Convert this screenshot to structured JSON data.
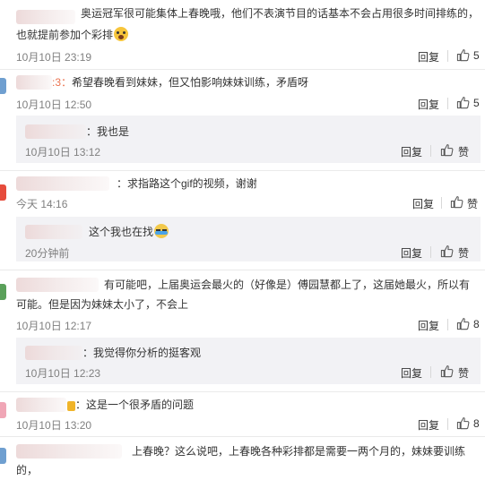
{
  "colors": {
    "mention": "#eb7350",
    "time": "#808080",
    "subcomment_bg": "#f2f2f5",
    "avatar_red": "#e64c3c",
    "avatar_blue": "#6fa8dc",
    "avatar_green": "#5aa05a",
    "avatar_pink": "#f0a6b6"
  },
  "icons": {
    "like": "thumbs-up-icon",
    "fear_emoji": "fear-face-emoji",
    "cry_emoji": "crying-face-emoji"
  },
  "comments": [
    {
      "text_line1": "奥运冠军很可能集体上春晚哦，他们不表演节目的话基本不会占用很多时间排练的，",
      "text_line2": "也就提前参加个彩排",
      "time": "10月10日 23:19",
      "reply": "回复",
      "likes": "5"
    },
    {
      "mention_suffix": ":3：",
      "text": "希望春晚看到妹妹，但又怕影响妹妹训练，矛盾呀",
      "time": "10月10日 12:50",
      "reply": "回复",
      "likes": "5",
      "subreply": {
        "text": "：我也是",
        "time": "10月10日 13:12",
        "reply": "回复",
        "likes": "赞"
      }
    },
    {
      "text": "：求指路这个gif的视频，谢谢",
      "time": "今天 14:16",
      "reply": "回复",
      "likes": "赞",
      "subreply": {
        "text": "这个我也在找",
        "time": "20分钟前",
        "reply": "回复",
        "likes": "赞"
      }
    },
    {
      "text_line1": "有可能吧，上届奥运会最火的（好像是）傅园慧都上了，这届她最火，所以有",
      "text_line2": "可能。但是因为妹妹太小了，不会上",
      "time": "10月10日 12:17",
      "reply": "回复",
      "likes": "8",
      "subreply": {
        "text": "：我觉得你分析的挺客观",
        "time": "10月10日 12:23",
        "reply": "回复",
        "likes": "赞"
      }
    },
    {
      "text": "：这是一个很矛盾的问题",
      "time": "10月10日 13:20",
      "reply": "回复",
      "likes": "8"
    },
    {
      "text_line1": "上春晚？这么说吧，上春晚各种彩排都是需要一两个月的，妹妹要训练",
      "text_line2": "的，"
    }
  ]
}
